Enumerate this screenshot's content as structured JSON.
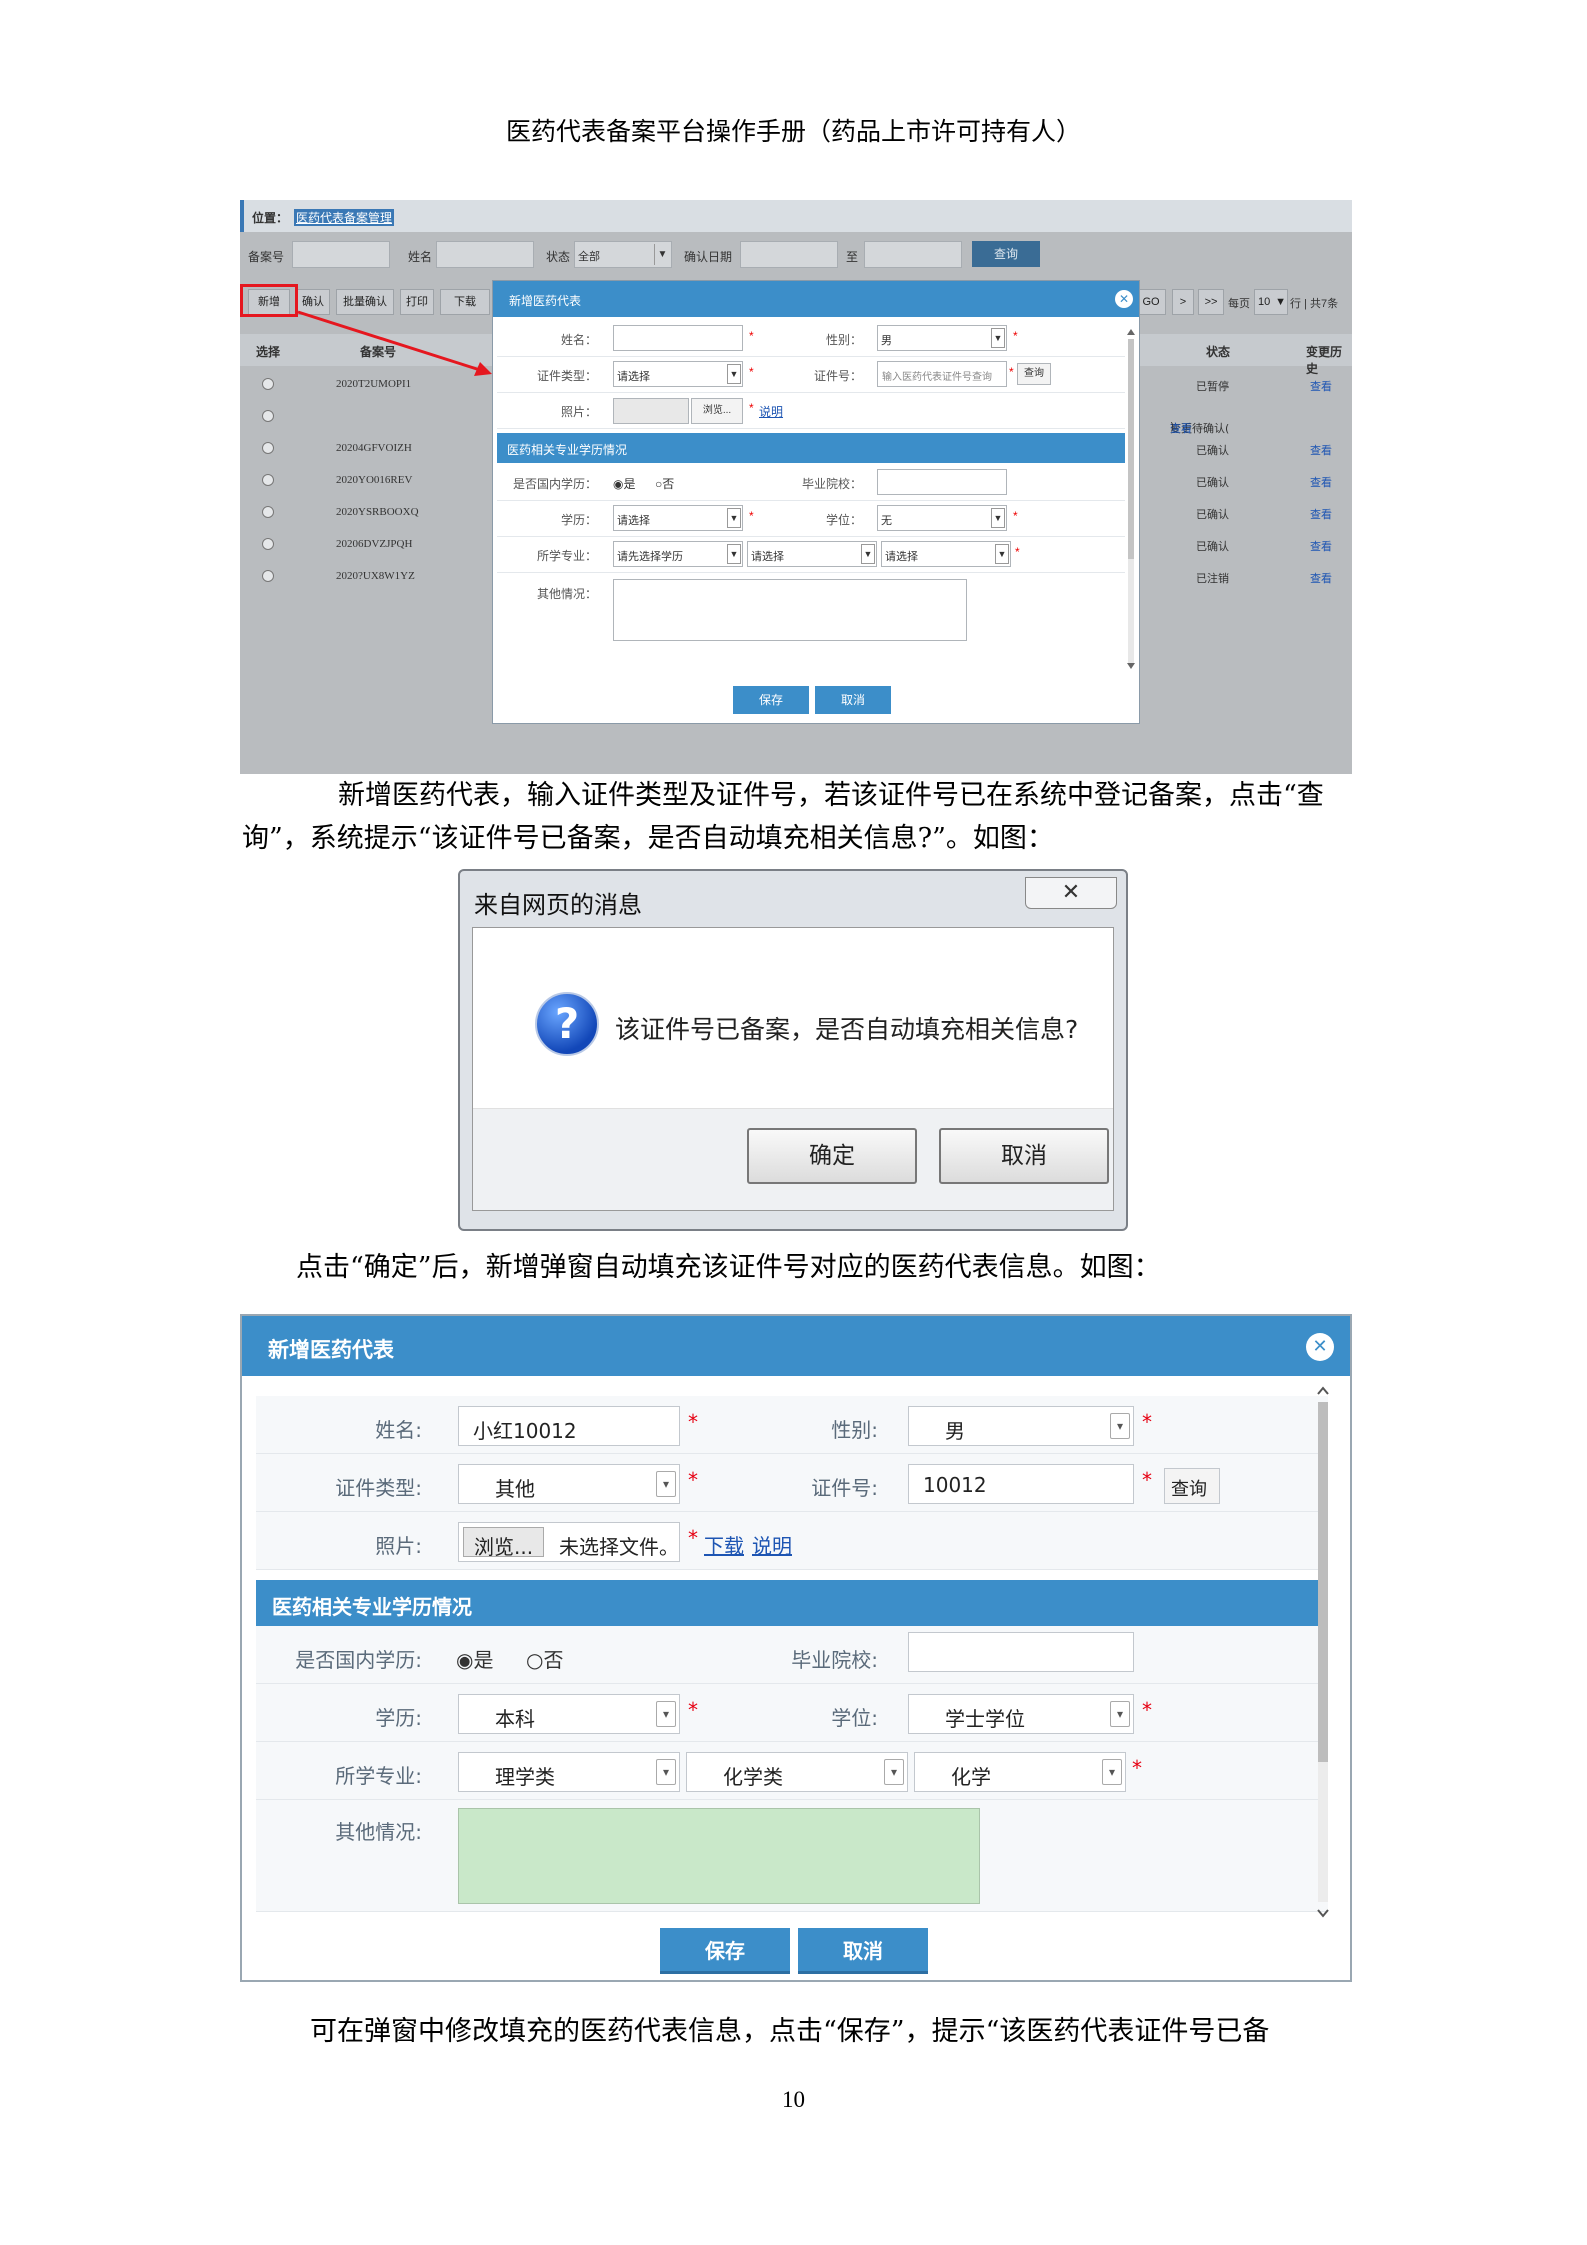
{
  "header": "医药代表备案平台操作手册（药品上市许可持有人）",
  "shot1": {
    "location_label": "位置：",
    "location_link": "医药代表备案管理",
    "search": {
      "record_no_label": "备案号",
      "name_label": "姓名",
      "status_label": "状态",
      "status_value": "全部",
      "confirm_date_label": "确认日期",
      "to_label": "至",
      "query_button": "查询"
    },
    "toolbar": {
      "add": "新增",
      "confirm": "确认",
      "batch_confirm": "批量确认",
      "print": "打印",
      "download": "下载",
      "go": "GO",
      "next": ">",
      "last": ">>",
      "per_page_label": "每页",
      "per_page_value": "10",
      "rows_total": "行 | 共7条"
    },
    "columns": [
      "选择",
      "备案号",
      "状态",
      "变更历史"
    ],
    "rows": [
      {
        "record_no": "2020T2UMOPI1",
        "status": "已暂停",
        "history": "查看"
      },
      {
        "record_no": "",
        "status": "变更待确认(",
        "status_link": "查看",
        "status_tail": ")",
        "history": ""
      },
      {
        "record_no": "20204GFVOIZH",
        "status": "已确认",
        "history": "查看"
      },
      {
        "record_no": "2020YO016REV",
        "status": "已确认",
        "history": "查看"
      },
      {
        "record_no": "2020YSRBOOXQ",
        "status": "已确认",
        "history": "查看"
      },
      {
        "record_no": "20206DVZJPQH",
        "status": "已确认",
        "history": "查看"
      },
      {
        "record_no": "2020?UX8W1YZ",
        "status": "已注销",
        "history": "查看"
      }
    ],
    "dialog": {
      "title": "新增医药代表",
      "name_label": "姓名：",
      "gender_label": "性别：",
      "gender_value": "男",
      "id_type_label": "证件类型：",
      "id_type_value": "请选择",
      "id_no_label": "证件号：",
      "id_no_placeholder": "输入医药代表证件号查询",
      "query_button": "查询",
      "photo_label": "照片：",
      "browse_button": "浏览...",
      "explain_link": "说明",
      "section_title": "医药相关专业学历情况",
      "domestic_label": "是否国内学历：",
      "yes": "是",
      "no": "否",
      "school_label": "毕业院校：",
      "education_label": "学历：",
      "education_value": "请选择",
      "degree_label": "学位：",
      "degree_value": "无",
      "major_label": "所学专业：",
      "major1": "请先选择学历",
      "major2": "请选择",
      "major3": "请选择",
      "other_label": "其他情况：",
      "save": "保存",
      "cancel": "取消"
    }
  },
  "para1": "新增医药代表，输入证件类型及证件号，若该证件号已在系统中登记备案，点击“查询”，系统提示“该证件号已备案，是否自动填充相关信息?”。如图：",
  "msgbox": {
    "title": "来自网页的消息",
    "message": "该证件号已备案，是否自动填充相关信息?",
    "ok": "确定",
    "cancel": "取消"
  },
  "para2": "点击“确定”后，新增弹窗自动填充该证件号对应的医药代表信息。如图：",
  "shot3": {
    "title": "新增医药代表",
    "name_label": "姓名:",
    "name_value": "小红10012",
    "gender_label": "性别:",
    "gender_value": "男",
    "id_type_label": "证件类型:",
    "id_type_value": "其他",
    "id_no_label": "证件号:",
    "id_no_value": "10012",
    "query_button": "查询",
    "photo_label": "照片:",
    "browse_button": "浏览...",
    "no_file_text": "未选择文件。",
    "download_link": "下载",
    "explain_link": "说明",
    "section_title": "医药相关专业学历情况",
    "domestic_label": "是否国内学历:",
    "yes": "是",
    "no": "否",
    "school_label": "毕业院校:",
    "education_label": "学历:",
    "education_value": "本科",
    "degree_label": "学位:",
    "degree_value": "学士学位",
    "major_label": "所学专业:",
    "major1": "理学类",
    "major2": "化学类",
    "major3": "化学",
    "other_label": "其他情况:",
    "save": "保存",
    "cancel": "取消"
  },
  "para3": "可在弹窗中修改填充的医药代表信息，点击“保存”，提示“该医药代表证件号已备",
  "page_number": "10"
}
